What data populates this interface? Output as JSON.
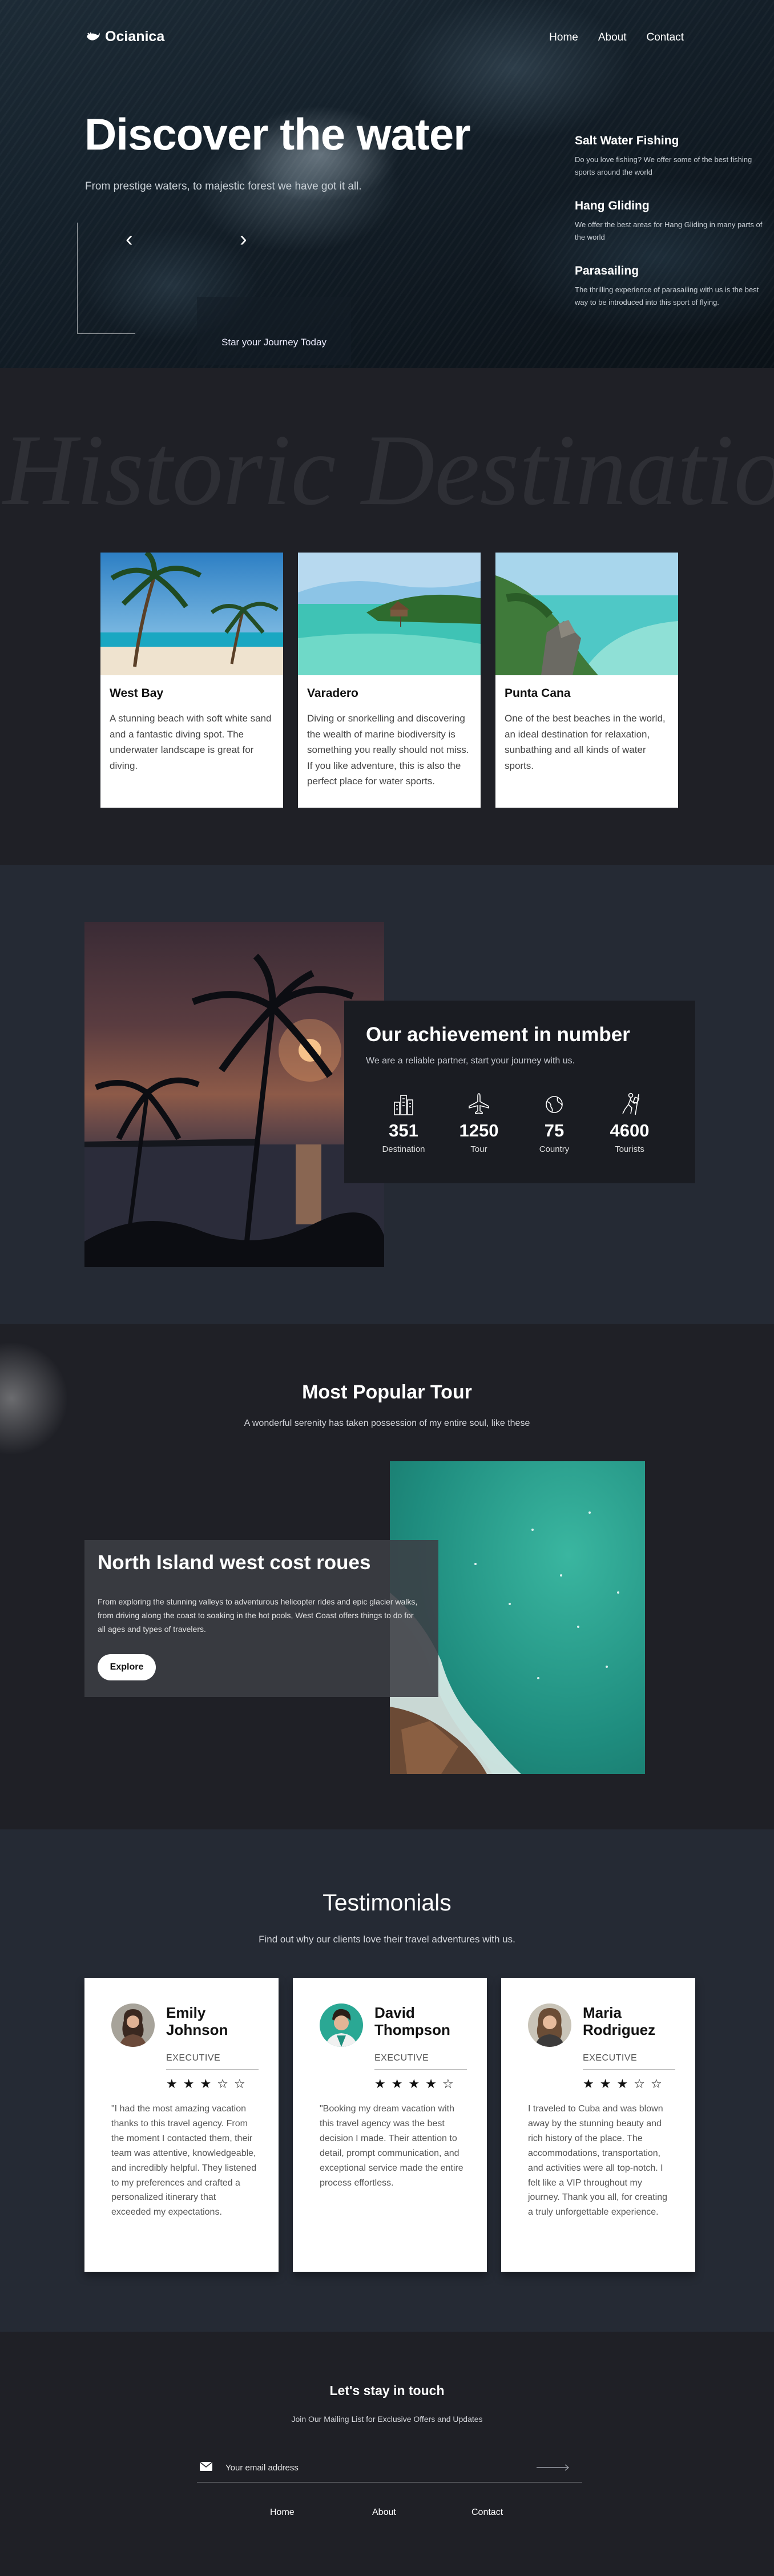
{
  "brand": {
    "name": "Ocianica"
  },
  "nav": {
    "items": [
      "Home",
      "About",
      "Contact"
    ]
  },
  "hero": {
    "title": "Discover the water",
    "subtitle": "From prestige waters, to majestic forest we have got it all.",
    "cta": "Star your Journey Today",
    "features": [
      {
        "title": "Salt Water Fishing",
        "text": "Do you love fishing? We offer some of the best fishing sports around the world"
      },
      {
        "title": "Hang Gliding",
        "text": "We offer the best areas for Hang Gliding in many parts of the world"
      },
      {
        "title": "Parasailing",
        "text": "The thrilling experience of parasailing with us is the best way to be introduced into this sport of flying."
      }
    ]
  },
  "destinations": {
    "watermark": "Historic Destinatio",
    "cards": [
      {
        "name": "West Bay",
        "text": "A stunning beach with soft white sand and a fantastic diving spot. The underwater landscape is great for diving."
      },
      {
        "name": "Varadero",
        "text": "Diving or snorkelling and discovering the wealth of marine biodiversity is something you really should not miss. If you like adventure, this is also the perfect place for water sports."
      },
      {
        "name": "Punta Cana",
        "text": "One of the best beaches in the world, an ideal destination for relaxation, sunbathing and all kinds of water sports."
      }
    ]
  },
  "achievement": {
    "title": "Our achievement in number",
    "subtitle": "We are a reliable partner, start your journey with us.",
    "stats": [
      {
        "value": "351",
        "label": "Destination",
        "icon": "city-icon"
      },
      {
        "value": "1250",
        "label": "Tour",
        "icon": "airplane-icon"
      },
      {
        "value": "75",
        "label": "Country",
        "icon": "globe-icon"
      },
      {
        "value": "4600",
        "label": "Tourists",
        "icon": "traveler-icon"
      }
    ]
  },
  "tour": {
    "title": "Most Popular Tour",
    "subtitle": "A wonderful serenity has taken possession of my entire soul, like these",
    "card_title": "North Island west cost roues",
    "card_text": "From exploring the stunning valleys to adventurous helicopter rides and epic glacier walks, from driving along the coast to soaking in the hot pools, West Coast offers things to do for all ages and types of travelers.",
    "button": "Explore"
  },
  "testimonials": {
    "title": "Testimonials",
    "subtitle": "Find out why our clients love their travel adventures with us.",
    "items": [
      {
        "name": "Emily Johnson",
        "role": "EXECUTIVE",
        "rating": 3,
        "text": "\"I had the most amazing vacation thanks to this travel agency. From the moment I contacted them, their team was attentive, knowledgeable, and incredibly helpful. They listened to my preferences and crafted a personalized itinerary that exceeded my expectations."
      },
      {
        "name": "David Thompson",
        "role": "EXECUTIVE",
        "rating": 4,
        "text": "\"Booking my dream vacation with this travel agency was the best decision I made. Their attention to detail, prompt communication, and exceptional service made the entire process effortless."
      },
      {
        "name": "Maria Rodriguez",
        "role": "EXECUTIVE",
        "rating": 3,
        "text": "I traveled to Cuba and was blown away by the stunning beauty and rich history of the place. The accommodations, transportation, and activities were all top-notch. I felt like a VIP throughout my journey. Thank you all, for creating a truly unforgettable experience."
      }
    ]
  },
  "footer": {
    "title": "Let's stay in touch",
    "subtitle": "Join Our Mailing List for Exclusive Offers and Updates",
    "email_placeholder": "Your email address",
    "links": [
      "Home",
      "About",
      "Contact"
    ]
  }
}
